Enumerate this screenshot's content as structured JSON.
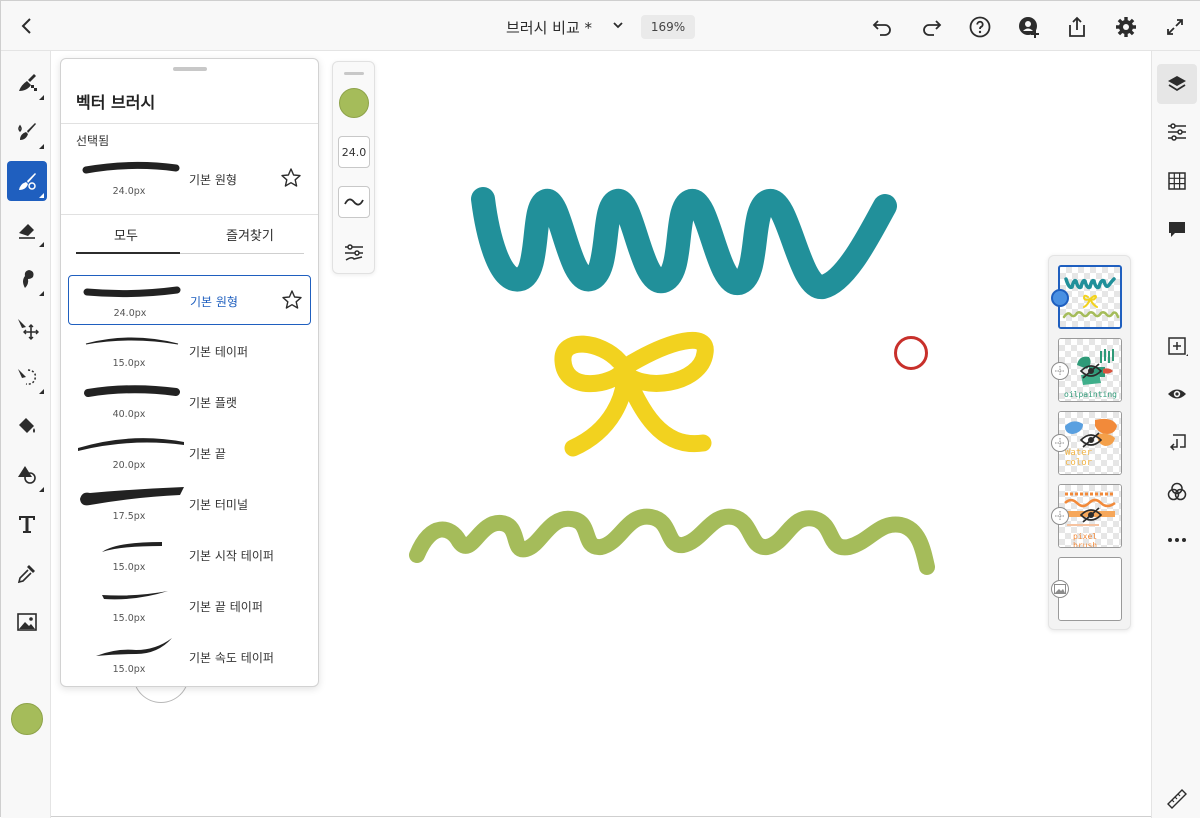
{
  "topbar": {
    "document_title": "브러시 비교 *",
    "zoom": "169%"
  },
  "brush_panel": {
    "title": "벡터 브러시",
    "selected_section_label": "선택됨",
    "selected_brush": {
      "name": "기본 원형",
      "size": "24.0px"
    },
    "tabs": [
      {
        "label": "모두",
        "active": true
      },
      {
        "label": "즐겨찾기",
        "active": false
      }
    ],
    "brushes": [
      {
        "name": "기본 원형",
        "size": "24.0px",
        "selected": true
      },
      {
        "name": "기본 테이퍼",
        "size": "15.0px"
      },
      {
        "name": "기본 플랫",
        "size": "40.0px"
      },
      {
        "name": "기본 끝",
        "size": "20.0px"
      },
      {
        "name": "기본 터미널",
        "size": "17.5px"
      },
      {
        "name": "기본 시작 테이퍼",
        "size": "15.0px"
      },
      {
        "name": "기본 끝 테이퍼",
        "size": "15.0px"
      },
      {
        "name": "기본 속도 테이퍼",
        "size": "15.0px"
      }
    ]
  },
  "minibar": {
    "brush_size": "24.0",
    "current_color": "#a5bc5a"
  },
  "colors": {
    "accent": "#1f5fbf",
    "teal_stroke": "#21909a",
    "yellow_stroke": "#f2d21f",
    "green_stroke": "#a5bc5a",
    "cursor_ring": "#c8302b"
  },
  "layers": {
    "thumb_texts": [
      "oilpainting",
      "Water color",
      "pixel brush"
    ]
  },
  "icons": {
    "left_tools": [
      "pixel-brush-icon",
      "live-brush-icon",
      "vector-brush-icon",
      "eraser-icon",
      "smudge-icon",
      "transform-icon",
      "lasso-icon",
      "fill-icon",
      "shape-icon",
      "text-icon",
      "eyedropper-icon",
      "image-icon"
    ],
    "right_tools": [
      "layers-icon",
      "layer-properties-icon",
      "grid-icon",
      "comment-icon",
      "add-layer-icon",
      "visibility-icon",
      "merge-icon",
      "blend-icon",
      "more-icon",
      "ruler-icon"
    ]
  }
}
